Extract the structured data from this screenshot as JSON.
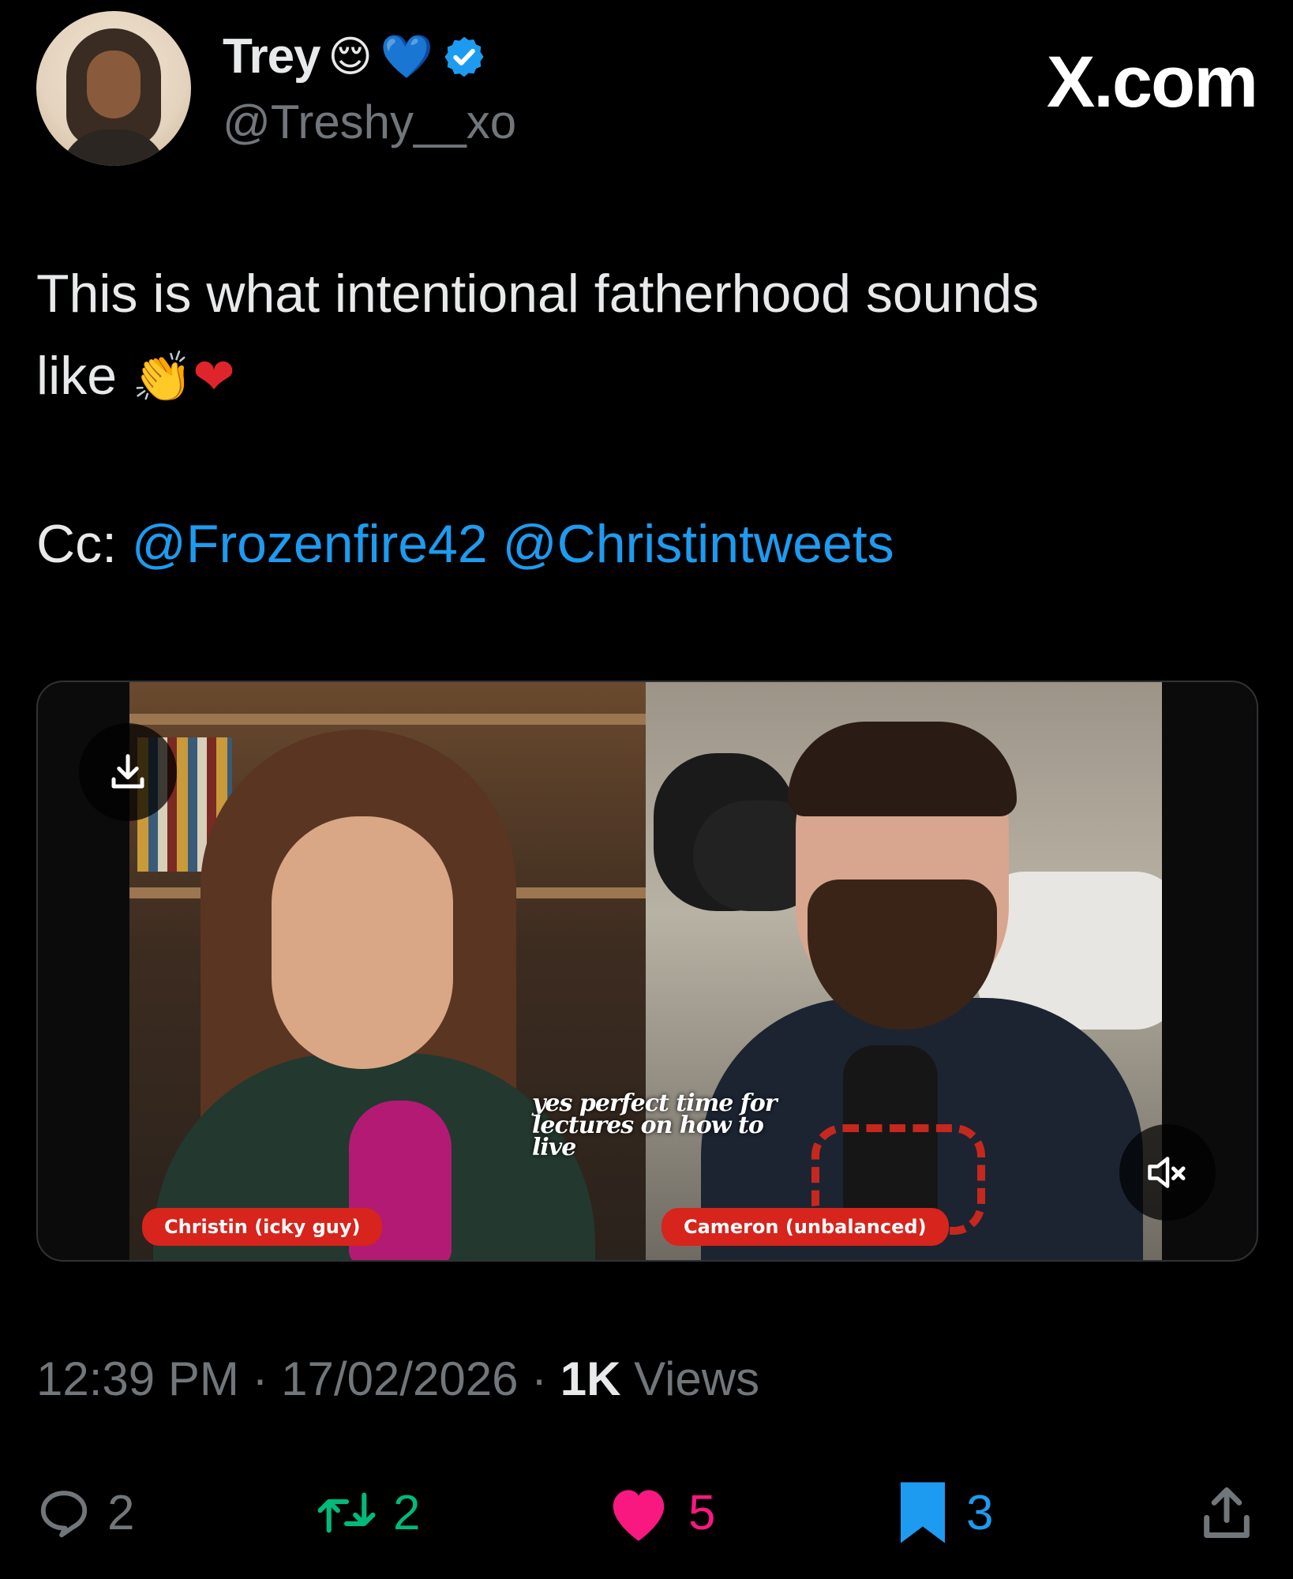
{
  "brand": "X.com",
  "author": {
    "name": "Trey",
    "name_emojis": [
      "😌",
      "💙"
    ],
    "handle": "@Treshy__xo",
    "verified_badge_color": "#1d9bf0"
  },
  "tweet": {
    "text_line1": "This is what intentional fatherhood sounds",
    "text_line2": "like",
    "emoji_clap": "👏",
    "emoji_heart": "❤",
    "cc_label": "Cc:",
    "mentions": [
      "@Frozenfire42",
      "@Christintweets"
    ]
  },
  "media": {
    "left_name_tag": "Christin (icky guy)",
    "right_name_tag": "Cameron (unbalanced)",
    "caption": "yes perfect time for lectures on how to live",
    "name_tag_color": "#d7241c"
  },
  "meta": {
    "time": "12:39 PM",
    "separator": "·",
    "date": "17/02/2026",
    "views_count": "1K",
    "views_label": "Views"
  },
  "actions": {
    "replies": "2",
    "retweets": "2",
    "likes": "5",
    "bookmarks": "3"
  },
  "colors": {
    "accent": "#1d9bf0",
    "retweet": "#00ba7c",
    "like": "#f91880",
    "muted_text": "#71767b"
  }
}
